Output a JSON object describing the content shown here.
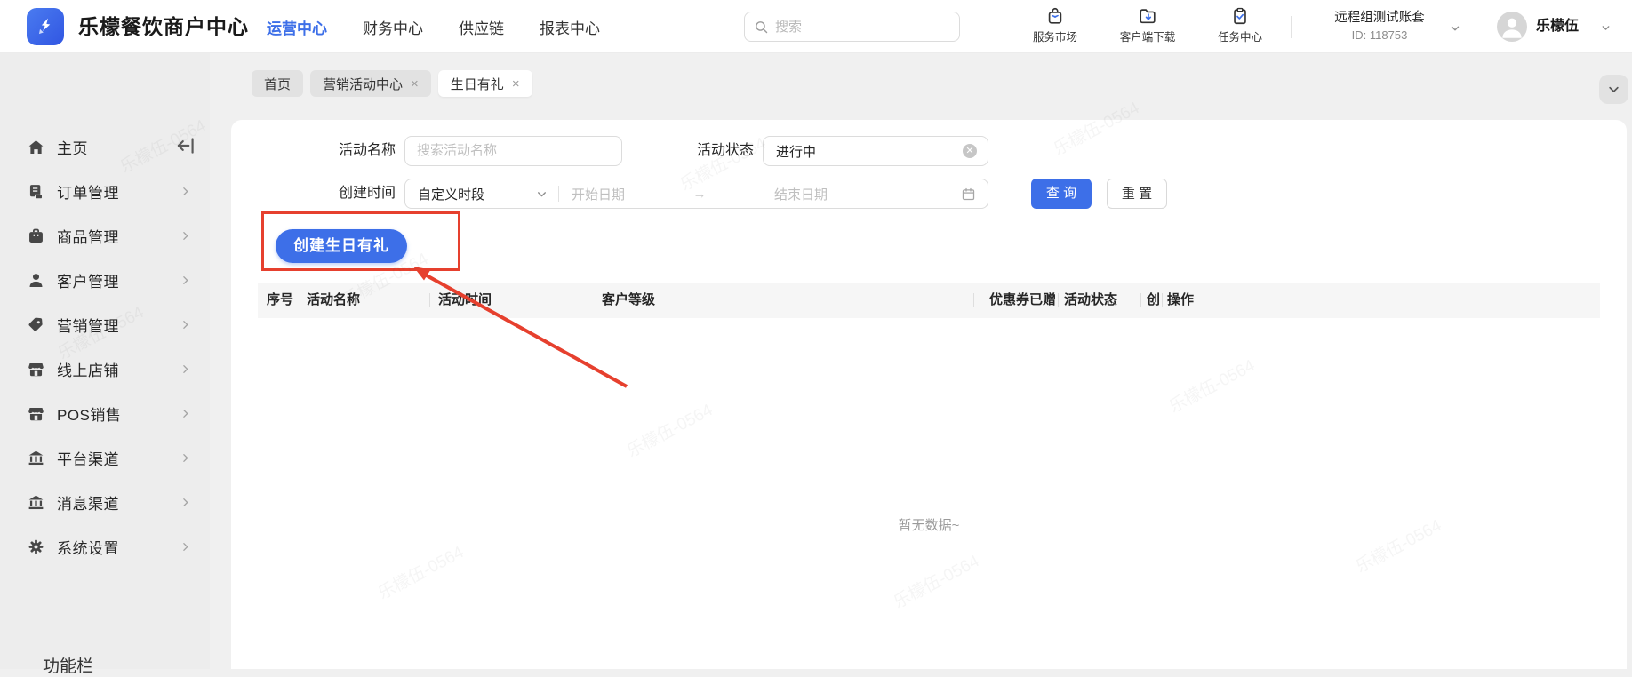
{
  "header": {
    "brand_title": "乐檬餐饮商户中心",
    "nav": [
      {
        "label": "运营中心",
        "active": true
      },
      {
        "label": "财务中心",
        "active": false
      },
      {
        "label": "供应链",
        "active": false
      },
      {
        "label": "报表中心",
        "active": false
      }
    ],
    "search_placeholder": "搜索",
    "tools": [
      {
        "label": "服务市场",
        "icon": "service-market-icon"
      },
      {
        "label": "客户端下载",
        "icon": "client-download-icon"
      },
      {
        "label": "任务中心",
        "icon": "task-center-icon"
      }
    ],
    "account": {
      "name": "远程组测试账套",
      "id": "ID: 118753"
    },
    "user": {
      "name": "乐檬伍"
    }
  },
  "sidebar": {
    "items": [
      {
        "label": "主页",
        "icon": "home-icon"
      },
      {
        "label": "订单管理",
        "icon": "orders-icon"
      },
      {
        "label": "商品管理",
        "icon": "products-icon"
      },
      {
        "label": "客户管理",
        "icon": "customers-icon"
      },
      {
        "label": "营销管理",
        "icon": "marketing-tag-icon"
      },
      {
        "label": "线上店铺",
        "icon": "online-store-icon"
      },
      {
        "label": "POS销售",
        "icon": "pos-store-icon"
      },
      {
        "label": "平台渠道",
        "icon": "platform-bank-icon"
      },
      {
        "label": "消息渠道",
        "icon": "message-bank-icon"
      },
      {
        "label": "系统设置",
        "icon": "settings-gear-icon"
      }
    ],
    "footer_clipped_text": "功能栏"
  },
  "tabs": [
    {
      "label": "首页",
      "closable": false,
      "active": false
    },
    {
      "label": "营销活动中心",
      "closable": true,
      "active": false
    },
    {
      "label": "生日有礼",
      "closable": true,
      "active": true
    }
  ],
  "filters": {
    "activity_name": {
      "label": "活动名称",
      "placeholder": "搜索活动名称"
    },
    "activity_status": {
      "label": "活动状态",
      "value": "进行中"
    },
    "create_time": {
      "label": "创建时间",
      "range_type_value": "自定义时段",
      "start_placeholder": "开始日期",
      "arrow": "→",
      "end_placeholder": "结束日期"
    },
    "query_button": "查 询",
    "reset_button": "重 置"
  },
  "actions": {
    "create_birthday_button": "创建生日有礼"
  },
  "table": {
    "columns": [
      "序号",
      "活动名称",
      "活动时间",
      "客户等级",
      "优惠券已赠",
      "活动状态",
      "创",
      "操作"
    ],
    "rows": [],
    "empty_text": "暂无数据~"
  },
  "watermark_text": "乐檬伍-0564",
  "colors": {
    "accent": "#3d6fe8",
    "annotation_red": "#e6402e",
    "sidebar_bg": "#ededed"
  }
}
